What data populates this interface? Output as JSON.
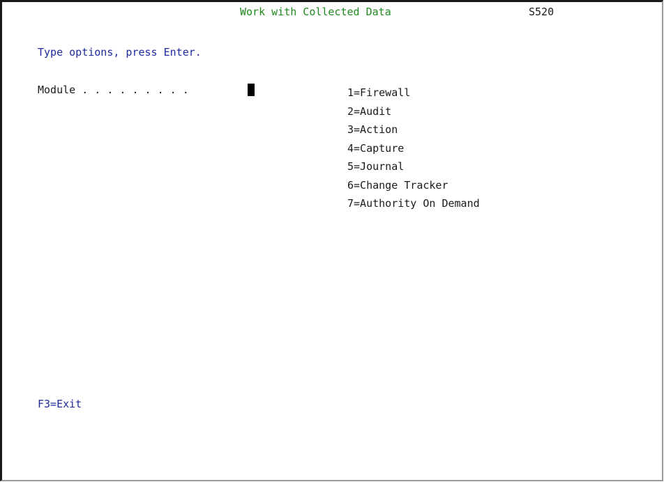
{
  "header": {
    "title": "Work with Collected Data",
    "system_name": "S520"
  },
  "instructions": "Type options, press Enter.",
  "module_prompt": {
    "label": "Module . . . . . . . . .",
    "value": ""
  },
  "options": [
    "1=Firewall",
    "2=Audit",
    "3=Action",
    "4=Capture",
    "5=Journal",
    "6=Change Tracker",
    "7=Authority On Demand"
  ],
  "function_keys": {
    "f3": "F3=Exit"
  },
  "colors": {
    "title": "#1f8a1f",
    "prompt_text": "#1e2a9c",
    "field_text": "#1a1a1a",
    "cursor": "#000000"
  }
}
